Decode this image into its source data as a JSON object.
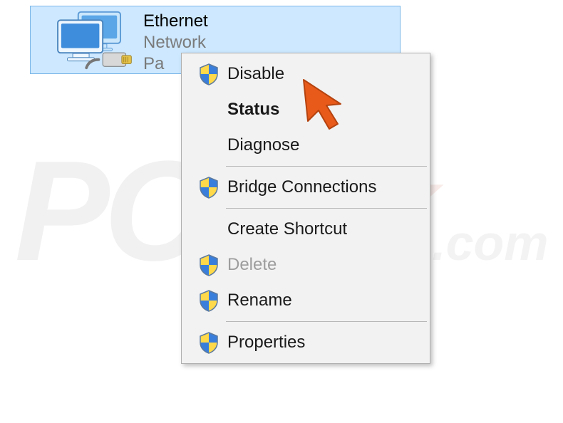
{
  "adapter": {
    "title": "Ethernet",
    "status": "Network",
    "device_prefix": "Pa"
  },
  "menu": {
    "disable": "Disable",
    "status": "Status",
    "diagnose": "Diagnose",
    "bridge": "Bridge Connections",
    "create_shortcut": "Create Shortcut",
    "delete": "Delete",
    "rename": "Rename",
    "properties": "Properties"
  },
  "watermark": {
    "pc": "PC",
    "risk": "risk",
    "com": ".com"
  },
  "icons": {
    "shield": "shield-icon",
    "network": "network-adapter-icon",
    "cursor": "cursor-pointer-icon"
  }
}
